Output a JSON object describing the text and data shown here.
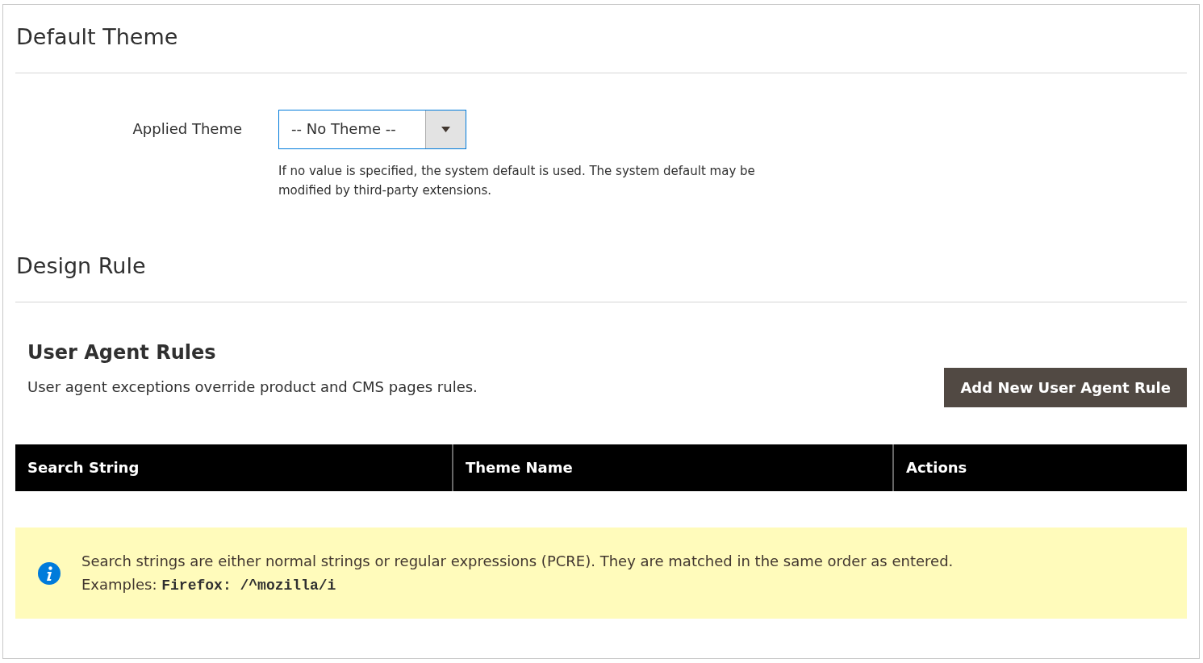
{
  "default_theme": {
    "title": "Default Theme",
    "field_label": "Applied Theme",
    "select_value": "-- No Theme --",
    "note": "If no value is specified, the system default is used. The system default may be modified by third-party extensions."
  },
  "design_rule": {
    "title": "Design Rule"
  },
  "user_agent_rules": {
    "title": "User Agent Rules",
    "description": "User agent exceptions override product and CMS pages rules.",
    "add_button": "Add New User Agent Rule",
    "table": {
      "columns": [
        "Search String",
        "Theme Name",
        "Actions"
      ]
    },
    "notice": {
      "text": "Search strings are either normal strings or regular expressions (PCRE). They are matched in the same order as entered.",
      "examples_label": "Examples:",
      "example_code": "Firefox: /^mozilla/i"
    }
  }
}
